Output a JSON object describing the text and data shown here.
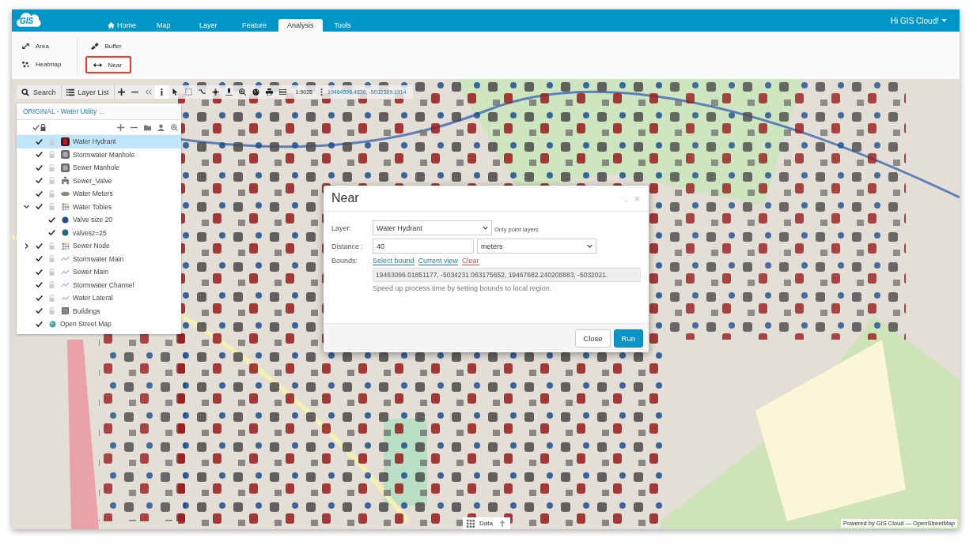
{
  "header": {
    "logo": "GIS",
    "user": "Hi GIS Cloud!",
    "tabs": [
      {
        "label": "Home",
        "kind": "home",
        "selected": false
      },
      {
        "label": "Map",
        "kind": "plain",
        "selected": false
      },
      {
        "label": "Layer",
        "kind": "plain",
        "selected": false
      },
      {
        "label": "Feature",
        "kind": "plain",
        "selected": false
      },
      {
        "label": "Analysis",
        "kind": "plain",
        "selected": true
      },
      {
        "label": "Tools",
        "kind": "plain",
        "selected": false
      }
    ]
  },
  "ribbon": {
    "groups": [
      [
        {
          "label": "Area",
          "kind": "area",
          "selected": false
        },
        {
          "label": "Heatmap",
          "kind": "heatmap",
          "selected": false
        }
      ],
      [
        {
          "label": "Buffer",
          "kind": "buffer",
          "selected": false
        },
        {
          "label": "Near",
          "kind": "near",
          "selected": true
        }
      ]
    ]
  },
  "toolbar": {
    "search": "Search",
    "layer_list": "Layer List",
    "tools": [
      {
        "kind": "zoom-in",
        "selected": false
      },
      {
        "kind": "zoom-out",
        "selected": false
      },
      {
        "kind": "collapse",
        "selected": false
      },
      {
        "kind": "info",
        "selected": true
      },
      {
        "kind": "pointer",
        "selected": false
      },
      {
        "kind": "select-box",
        "selected": false
      },
      {
        "kind": "freehand",
        "selected": false
      },
      {
        "kind": "pan",
        "selected": false
      },
      {
        "kind": "pin",
        "selected": false
      },
      {
        "kind": "zoom",
        "selected": false
      },
      {
        "kind": "globe",
        "selected": false
      },
      {
        "kind": "print",
        "selected": false
      },
      {
        "kind": "measure",
        "selected": false
      }
    ],
    "scale": "1:9028",
    "coordinates": "19464598.4838, -5032389.1914"
  },
  "layers_panel": {
    "title": "ORIGINAL - Water Utility ...",
    "layers": [
      {
        "name": "Water Hydrant",
        "kind": "hydrant",
        "visible": true,
        "locked": false,
        "selected": true
      },
      {
        "name": "Stormwater Manhole",
        "kind": "manhole",
        "visible": true,
        "locked": false,
        "selected": false
      },
      {
        "name": "Sewer Manhole",
        "kind": "manhole",
        "visible": true,
        "locked": false,
        "selected": false
      },
      {
        "name": "Sewer_Valve",
        "kind": "valve",
        "visible": true,
        "locked": false,
        "selected": false
      },
      {
        "name": "Water Meters",
        "kind": "meter",
        "visible": true,
        "locked": false,
        "selected": false
      },
      {
        "name": "Water Tobies",
        "kind": "categories",
        "visible": true,
        "locked": false,
        "selected": false,
        "expanded": true,
        "children": [
          {
            "name": "Valve size 20",
            "kind": "dot",
            "color": "#1f4e8c",
            "visible": true,
            "selected": false
          },
          {
            "name": "valvesz=25",
            "kind": "dot",
            "color": "#1f6a7a",
            "visible": true,
            "selected": false
          }
        ]
      },
      {
        "name": "Sewer Node",
        "kind": "categories",
        "visible": true,
        "locked": false,
        "selected": false,
        "expanded": false
      },
      {
        "name": "Stormwater Main",
        "kind": "line",
        "visible": true,
        "locked": false,
        "selected": false
      },
      {
        "name": "Sewer Main",
        "kind": "line",
        "visible": true,
        "locked": false,
        "selected": false
      },
      {
        "name": "Stormwater Channel",
        "kind": "line",
        "visible": true,
        "locked": false,
        "selected": false
      },
      {
        "name": "Water Lateral",
        "kind": "line",
        "visible": true,
        "locked": false,
        "selected": false
      },
      {
        "name": "Buildings",
        "kind": "building",
        "visible": true,
        "locked": false,
        "selected": false
      },
      {
        "name": "Open Street Map",
        "kind": "basemap",
        "visible": true,
        "selected": false
      }
    ]
  },
  "dialog": {
    "title": "Near",
    "layer": {
      "label": "Layer:",
      "value": "Water Hydrant",
      "hint": "Only point layers"
    },
    "distance": {
      "label": "Distance :",
      "value": "40",
      "unit": "meters"
    },
    "bounds": {
      "label": "Bounds:",
      "links": [
        {
          "label": "Select bound",
          "kind": "normal"
        },
        {
          "label": "Current view",
          "kind": "normal"
        },
        {
          "label": "Clear",
          "kind": "danger"
        }
      ],
      "value": "19463096.01851177, -5034231.063175652, 19467682.240208883, -5032021.",
      "help": "Speed up process time by setting bounds to local region."
    },
    "buttons": [
      {
        "label": "Close",
        "kind": "default"
      },
      {
        "label": "Run",
        "kind": "primary"
      }
    ]
  },
  "data_tab": "Data",
  "attribution": "Powered by GIS Cloud — OpenStreetMap"
}
